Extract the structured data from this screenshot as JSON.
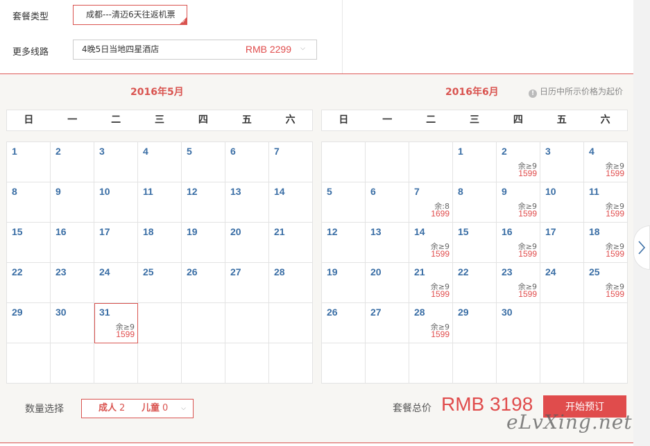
{
  "options": {
    "package_type_label": "套餐类型",
    "package_type_value": "成都---清迈6天往返机票",
    "more_routes_label": "更多线路",
    "more_routes_value": "4晚5日当地四星酒店",
    "more_routes_price": "RMB 2299"
  },
  "calendar": {
    "hint": "日历中所示价格为起价",
    "weekdays": [
      "日",
      "一",
      "二",
      "三",
      "四",
      "五",
      "六"
    ],
    "months": [
      {
        "title": "2016年5月",
        "cells": [
          {
            "day": "1"
          },
          {
            "day": "2"
          },
          {
            "day": "3"
          },
          {
            "day": "4"
          },
          {
            "day": "5"
          },
          {
            "day": "6"
          },
          {
            "day": "7"
          },
          {
            "day": "8"
          },
          {
            "day": "9"
          },
          {
            "day": "10"
          },
          {
            "day": "11"
          },
          {
            "day": "12"
          },
          {
            "day": "13"
          },
          {
            "day": "14"
          },
          {
            "day": "15"
          },
          {
            "day": "16"
          },
          {
            "day": "17"
          },
          {
            "day": "18"
          },
          {
            "day": "19"
          },
          {
            "day": "20"
          },
          {
            "day": "21"
          },
          {
            "day": "22"
          },
          {
            "day": "23"
          },
          {
            "day": "24"
          },
          {
            "day": "25"
          },
          {
            "day": "26"
          },
          {
            "day": "27"
          },
          {
            "day": "28"
          },
          {
            "day": "29"
          },
          {
            "day": "30"
          },
          {
            "day": "31",
            "remain": "余≥9",
            "price": "1599",
            "selected": true
          },
          {},
          {},
          {},
          {},
          {},
          {},
          {},
          {},
          {},
          {},
          {}
        ]
      },
      {
        "title": "2016年6月",
        "cells": [
          {},
          {},
          {},
          {
            "day": "1"
          },
          {
            "day": "2",
            "remain": "余≥9",
            "price": "1599"
          },
          {
            "day": "3"
          },
          {
            "day": "4",
            "remain": "余≥9",
            "price": "1599"
          },
          {
            "day": "5"
          },
          {
            "day": "6"
          },
          {
            "day": "7",
            "remain": "余:8",
            "price": "1699"
          },
          {
            "day": "8"
          },
          {
            "day": "9",
            "remain": "余≥9",
            "price": "1599"
          },
          {
            "day": "10"
          },
          {
            "day": "11",
            "remain": "余≥9",
            "price": "1599"
          },
          {
            "day": "12"
          },
          {
            "day": "13"
          },
          {
            "day": "14",
            "remain": "余≥9",
            "price": "1599"
          },
          {
            "day": "15"
          },
          {
            "day": "16",
            "remain": "余≥9",
            "price": "1599"
          },
          {
            "day": "17"
          },
          {
            "day": "18",
            "remain": "余≥9",
            "price": "1599"
          },
          {
            "day": "19"
          },
          {
            "day": "20"
          },
          {
            "day": "21",
            "remain": "余≥9",
            "price": "1599"
          },
          {
            "day": "22"
          },
          {
            "day": "23",
            "remain": "余≥9",
            "price": "1599"
          },
          {
            "day": "24"
          },
          {
            "day": "25",
            "remain": "余≥9",
            "price": "1599"
          },
          {
            "day": "26"
          },
          {
            "day": "27"
          },
          {
            "day": "28",
            "remain": "余≥9",
            "price": "1599"
          },
          {
            "day": "29"
          },
          {
            "day": "30"
          },
          {},
          {},
          {},
          {},
          {},
          {},
          {},
          {},
          {}
        ]
      }
    ]
  },
  "footer": {
    "qty_label": "数量选择",
    "adult_label": "成人",
    "adult_count": "2",
    "child_label": "儿童",
    "child_count": "0",
    "total_label": "套餐总价",
    "total_price": "RMB 3198",
    "book_button": "开始预订"
  },
  "watermark": "eLvXing.net",
  "icons": {
    "dropdown": "chevron-down-icon",
    "info": "info-icon",
    "next": "chevron-right-icon",
    "check": "check-icon"
  },
  "colors": {
    "accent": "#d9534f",
    "price": "#e04c4c",
    "day_number": "#3a6ea5",
    "calendar_bg": "#f7f6f3"
  }
}
